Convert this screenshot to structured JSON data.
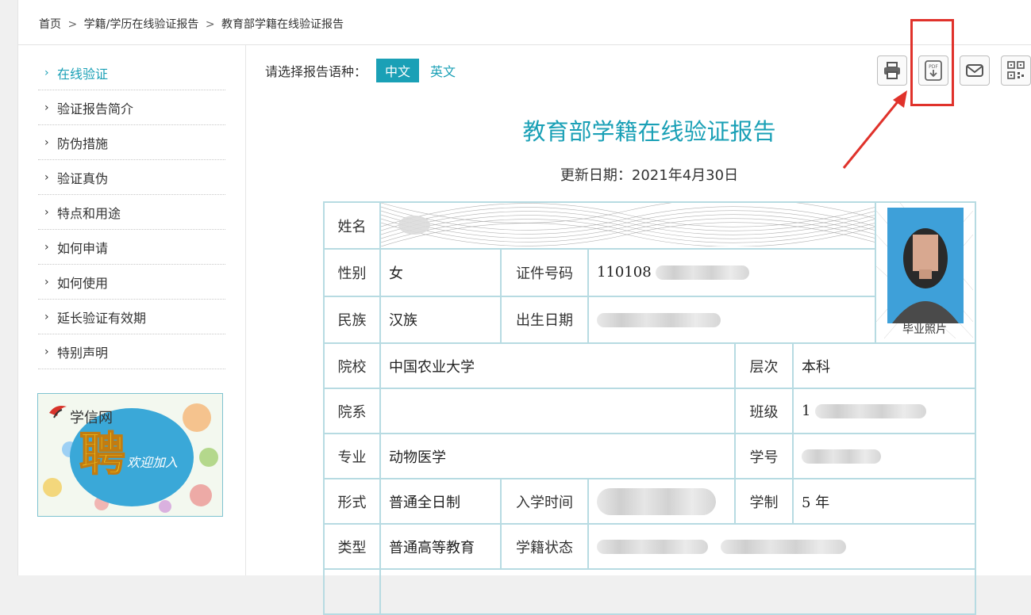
{
  "breadcrumb": {
    "home": "首页",
    "level2": "学籍/学历在线验证报告",
    "current": "教育部学籍在线验证报告",
    "separator": ">"
  },
  "sidebar": {
    "items": [
      {
        "label": "在线验证",
        "active": true
      },
      {
        "label": "验证报告简介",
        "active": false
      },
      {
        "label": "防伪措施",
        "active": false
      },
      {
        "label": "验证真伪",
        "active": false
      },
      {
        "label": "特点和用途",
        "active": false
      },
      {
        "label": "如何申请",
        "active": false
      },
      {
        "label": "如何使用",
        "active": false
      },
      {
        "label": "延长验证有效期",
        "active": false
      },
      {
        "label": "特别声明",
        "active": false
      }
    ],
    "banner": {
      "brand": "学信网",
      "big_char": "聘",
      "slogan": "欢迎加入"
    }
  },
  "language": {
    "label": "请选择报告语种：",
    "options": [
      "中文",
      "英文"
    ],
    "selected": "中文"
  },
  "toolbar": {
    "icons": [
      "print-icon",
      "pdf-download-icon",
      "mail-icon",
      "qrcode-icon"
    ],
    "highlighted": "pdf-download-icon"
  },
  "report": {
    "title": "教育部学籍在线验证报告",
    "updated": "更新日期：2021年4月30日",
    "photo_caption": "毕业照片",
    "fields": {
      "name_label": "姓名",
      "gender_label": "性别",
      "gender_value": "女",
      "id_label": "证件号码",
      "id_value": "110108",
      "ethnicity_label": "民族",
      "ethnicity_value": "汉族",
      "birth_label": "出生日期",
      "school_label": "院校",
      "school_value": "中国农业大学",
      "level_label": "层次",
      "level_value": "本科",
      "dept_label": "院系",
      "class_label": "班级",
      "class_value": "1",
      "major_label": "专业",
      "major_value": "动物医学",
      "student_no_label": "学号",
      "form_label": "形式",
      "form_value": "普通全日制",
      "enroll_label": "入学时间",
      "duration_label": "学制",
      "duration_value": "5 年",
      "type_label": "类型",
      "type_value": "普通高等教育",
      "status_label": "学籍状态"
    }
  },
  "colors": {
    "accent": "#1aa0b6",
    "table_border": "#b7dbe2",
    "highlight": "#e0322b"
  }
}
